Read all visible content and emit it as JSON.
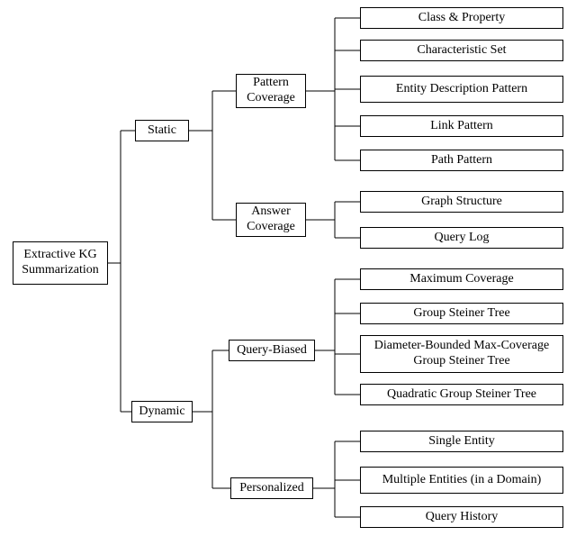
{
  "root": "Extractive KG Summarization",
  "level1": {
    "static": "Static",
    "dynamic": "Dynamic"
  },
  "level2": {
    "pattern": "Pattern Coverage",
    "answer": "Answer Coverage",
    "query": "Query-Biased",
    "personal": "Personalized"
  },
  "leaves": {
    "l1": "Class & Property",
    "l2": "Characteristic Set",
    "l3": "Entity Description Pattern",
    "l4": "Link Pattern",
    "l5": "Path Pattern",
    "l6": "Graph Structure",
    "l7": "Query Log",
    "l8": "Maximum Coverage",
    "l9": "Group Steiner Tree",
    "l10": "Diameter-Bounded Max-Coverage Group Steiner Tree",
    "l11": "Quadratic Group Steiner Tree",
    "l12": "Single Entity",
    "l13": "Multiple Entities (in a Domain)",
    "l14": "Query History"
  }
}
